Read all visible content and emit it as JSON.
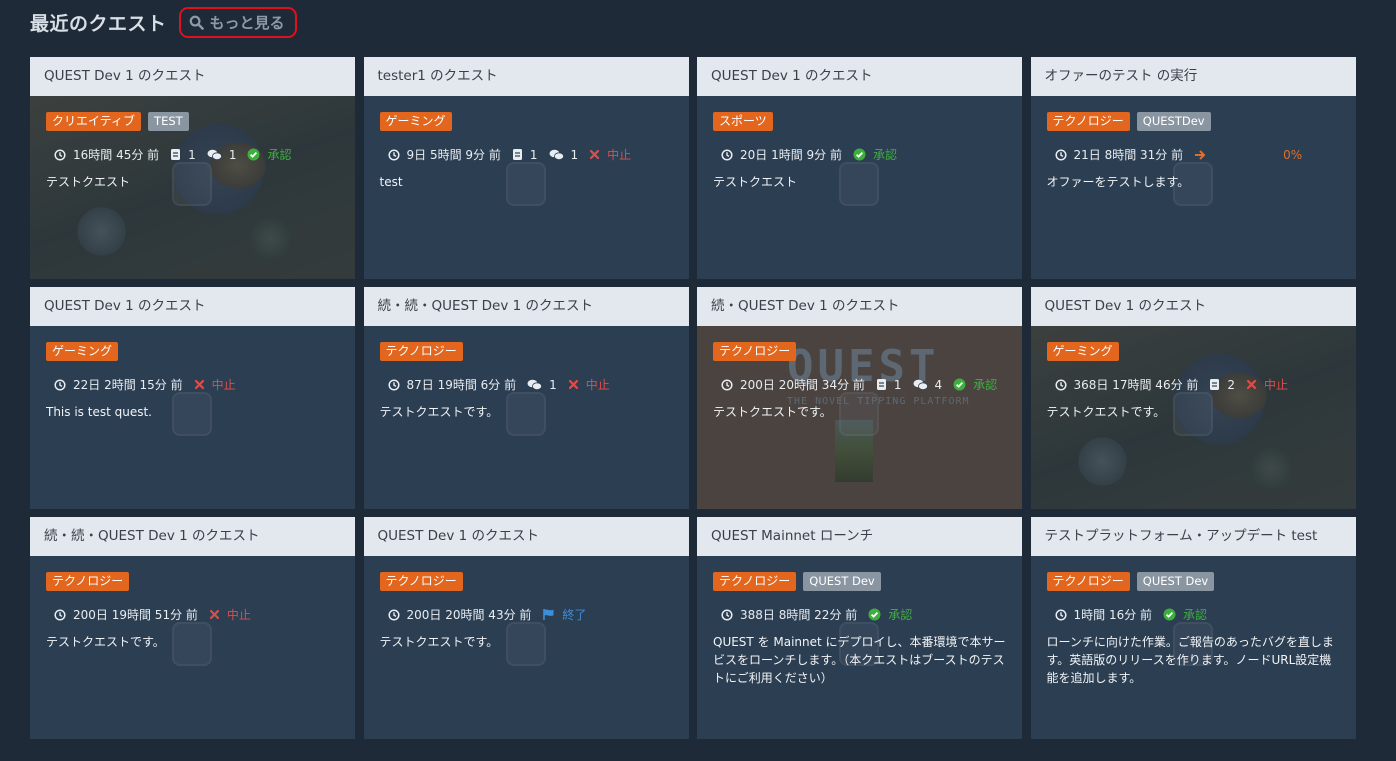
{
  "header": {
    "title": "最近のクエスト",
    "more_label": "もっと見る"
  },
  "colors": {
    "accent_tag": "#e2661d",
    "secondary_tag": "#8a95a2",
    "status_ok": "#3fae3f",
    "status_stop": "#e04d48",
    "status_done": "#3d8fd8"
  },
  "cards": [
    {
      "title": "QUEST Dev 1 のクエスト",
      "tags": [
        "クリエイティブ",
        "TEST"
      ],
      "time": "16時間 45分 前",
      "docs": "1",
      "comments": "1",
      "status": "承認",
      "desc": "テストクエスト",
      "bg": "food"
    },
    {
      "title": "tester1 のクエスト",
      "tags": [
        "ゲーミング"
      ],
      "time": "9日 5時間 9分 前",
      "docs": "1",
      "comments": "1",
      "status": "中止",
      "desc": "test"
    },
    {
      "title": "QUEST Dev 1 のクエスト",
      "tags": [
        "スポーツ"
      ],
      "time": "20日 1時間 9分 前",
      "status": "承認",
      "desc": "テストクエスト"
    },
    {
      "title": "オファーのテスト の実行",
      "tags": [
        "テクノロジー",
        "QUESTDev"
      ],
      "time": "21日 8時間 31分 前",
      "progress": "0%",
      "desc": "オファーをテストします。"
    },
    {
      "title": "QUEST Dev 1 のクエスト",
      "tags": [
        "ゲーミング"
      ],
      "time": "22日 2時間 15分 前",
      "status": "中止",
      "desc": "This is test quest."
    },
    {
      "title": "続・続・QUEST Dev 1 のクエスト",
      "tags": [
        "テクノロジー"
      ],
      "time": "87日 19時間 6分 前",
      "comments": "1",
      "status": "中止",
      "desc": "テストクエストです。"
    },
    {
      "title": "続・QUEST Dev 1 のクエスト",
      "tags": [
        "テクノロジー"
      ],
      "time": "200日 20時間 34分 前",
      "docs": "1",
      "comments": "4",
      "status": "承認",
      "desc": "テストクエストです。",
      "bg": "quest",
      "bg_text": "QUEST",
      "bg_subtext": "THE NOVEL TIPPING PLATFORM"
    },
    {
      "title": "QUEST Dev 1 のクエスト",
      "tags": [
        "ゲーミング"
      ],
      "time": "368日 17時間 46分 前",
      "docs": "2",
      "status": "中止",
      "desc": "テストクエストです。",
      "bg": "food"
    },
    {
      "title": "続・続・QUEST Dev 1 のクエスト",
      "tags": [
        "テクノロジー"
      ],
      "time": "200日 19時間 51分 前",
      "status": "中止",
      "desc": "テストクエストです。"
    },
    {
      "title": "QUEST Dev 1 のクエスト",
      "tags": [
        "テクノロジー"
      ],
      "time": "200日 20時間 43分 前",
      "status": "終了",
      "desc": "テストクエストです。"
    },
    {
      "title": "QUEST Mainnet ローンチ",
      "tags": [
        "テクノロジー",
        "QUEST Dev"
      ],
      "time": "388日 8時間 22分 前",
      "status": "承認",
      "desc": "QUEST を Mainnet にデプロイし、本番環境で本サービスをローンチします。（本クエストはブーストのテストにご利用ください）"
    },
    {
      "title": "テストプラットフォーム・アップデート test",
      "tags": [
        "テクノロジー",
        "QUEST Dev"
      ],
      "time": "1時間 16分 前",
      "status": "承認",
      "desc": "ローンチに向けた作業。ご報告のあったバグを直します。英語版のリリースを作ります。ノードURL設定機能を追加します。"
    }
  ]
}
